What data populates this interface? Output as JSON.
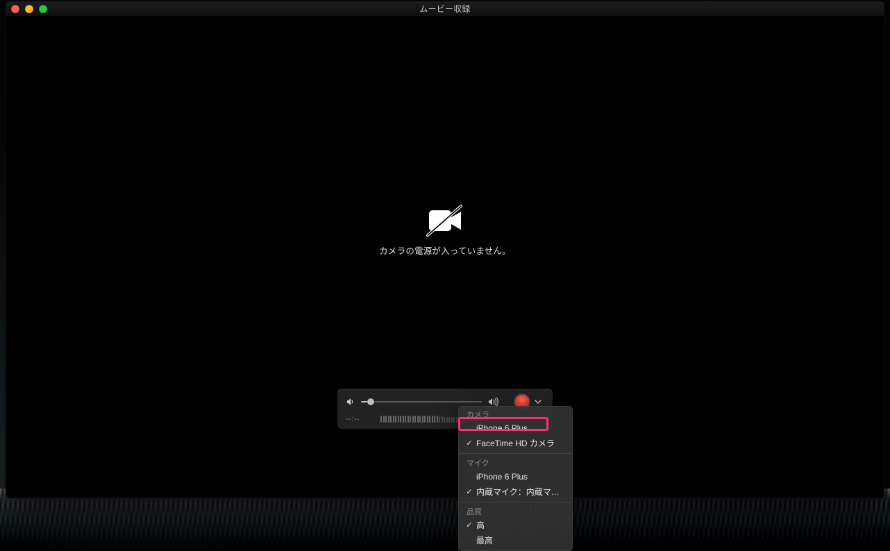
{
  "window": {
    "title": "ムービー収録"
  },
  "camera_message": "カメラの電源が入っていません。",
  "controls": {
    "time": "--:--",
    "volume_percent": 8
  },
  "menu": {
    "sections": [
      {
        "title": "カメラ",
        "items": [
          {
            "label": "iPhone 6 Plus",
            "checked": false
          },
          {
            "label": "FaceTime HD カメラ",
            "checked": true
          }
        ]
      },
      {
        "title": "マイク",
        "items": [
          {
            "label": "iPhone 6 Plus",
            "checked": false
          },
          {
            "label": "内蔵マイク：内蔵マイク",
            "checked": true
          }
        ]
      },
      {
        "title": "品質",
        "items": [
          {
            "label": "高",
            "checked": true
          },
          {
            "label": "最高",
            "checked": false
          }
        ]
      }
    ]
  },
  "icons": {
    "camera_off": "camera-off-icon",
    "volume_low": "volume-low-icon",
    "volume_high": "volume-high-icon",
    "chevron_down": "chevron-down-icon"
  }
}
